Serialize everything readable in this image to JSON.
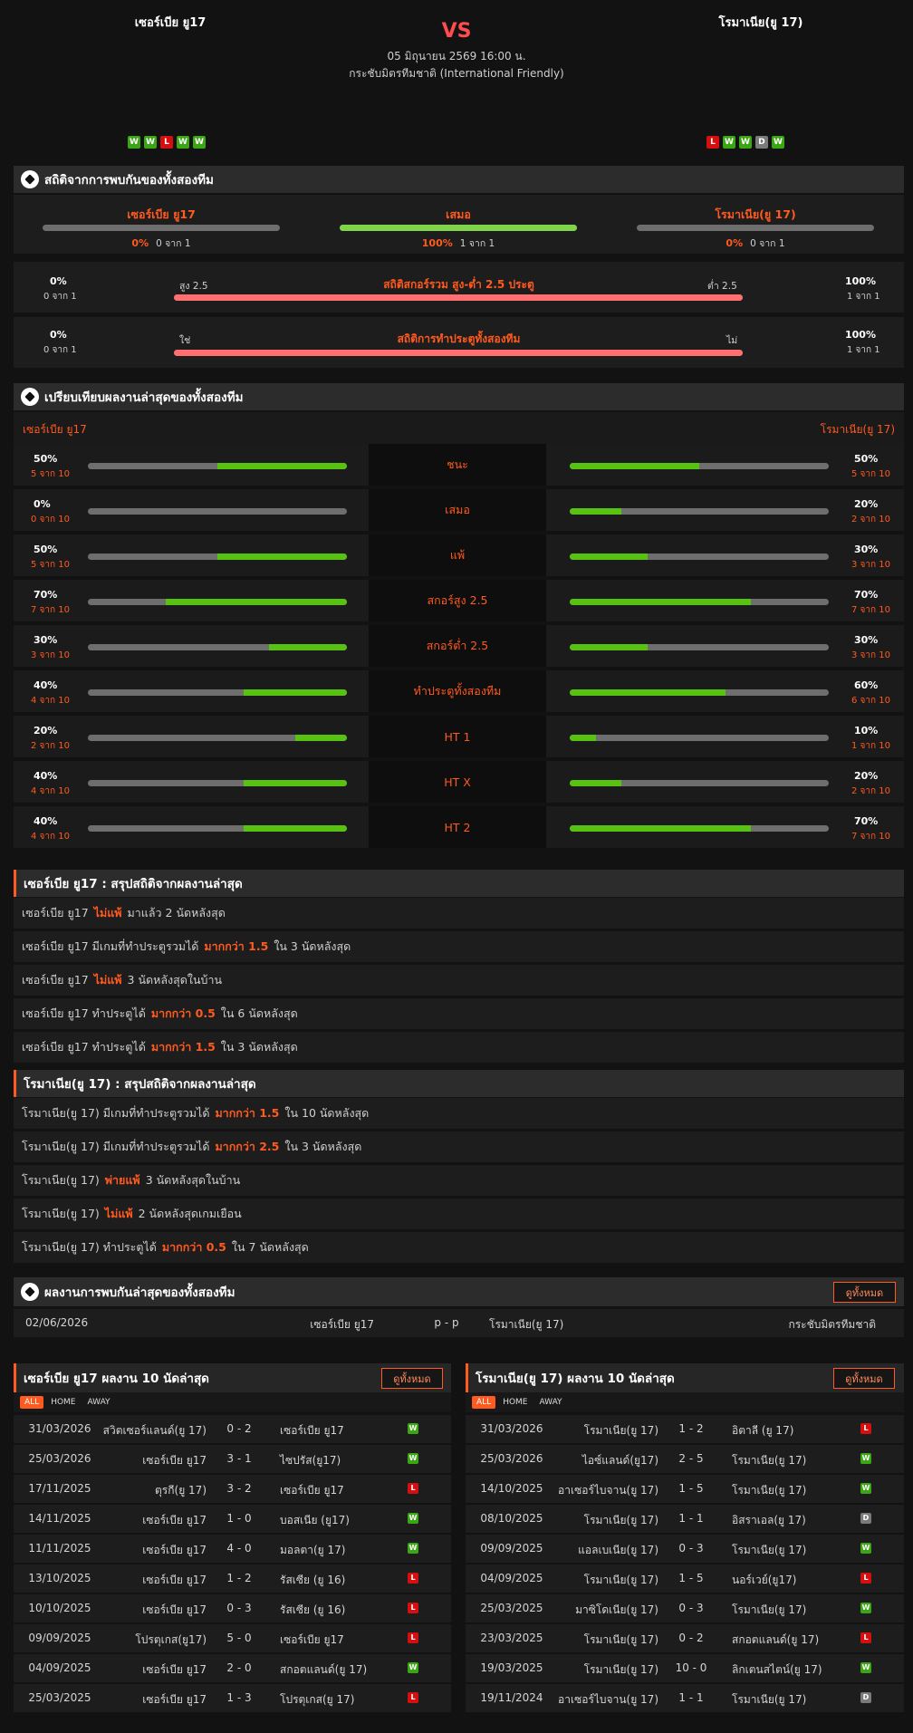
{
  "header": {
    "home": "เซอร์เบีย ยู17",
    "away": "โรมาเนีย(ยู 17)",
    "vs": "VS",
    "datetime": "05 มิถุนายน 2569 16:00 น.",
    "competition": "กระชับมิตรทีมชาติ (International Friendly)",
    "home_form": [
      "W",
      "W",
      "L",
      "W",
      "W"
    ],
    "away_form": [
      "L",
      "W",
      "W",
      "D",
      "W"
    ]
  },
  "h2h_stats": {
    "title": "สถิติจากการพบกันของทั้งสองทีม",
    "results": [
      {
        "label": "เซอร์เบีย ยู17",
        "pct": "0%",
        "frac": "0 จาก 1",
        "value": 0
      },
      {
        "label": "เสมอ",
        "pct": "100%",
        "frac": "1 จาก 1",
        "value": 100
      },
      {
        "label": "โรมาเนีย(ยู 17)",
        "pct": "0%",
        "frac": "0 จาก 1",
        "value": 0
      }
    ],
    "ou": {
      "left_pct": "0%",
      "left_frac": "0 จาก 1",
      "left_label": "สูง 2.5",
      "title": "สถิติสกอร์รวม สูง-ต่ำ 2.5 ประตู",
      "right_label": "ต่ำ 2.5",
      "right_pct": "100%",
      "right_frac": "1 จาก 1",
      "value": 100
    },
    "btts": {
      "left_pct": "0%",
      "left_frac": "0 จาก 1",
      "left_label": "ใช่",
      "title": "สถิติการทำประตูทั้งสองทีม",
      "right_label": "ไม่",
      "right_pct": "100%",
      "right_frac": "1 จาก 1",
      "value": 100
    }
  },
  "compare": {
    "title": "เปรียบเทียบผลงานล่าสุดของทั้งสองทีม",
    "home": "เซอร์เบีย ยู17",
    "away": "โรมาเนีย(ยู 17)",
    "rows": [
      {
        "label": "ชนะ",
        "hp": "50%",
        "hf": "5 จาก 10",
        "hv": 50,
        "ap": "50%",
        "af": "5 จาก 10",
        "av": 50
      },
      {
        "label": "เสมอ",
        "hp": "0%",
        "hf": "0 จาก 10",
        "hv": 0,
        "ap": "20%",
        "af": "2 จาก 10",
        "av": 20
      },
      {
        "label": "แพ้",
        "hp": "50%",
        "hf": "5 จาก 10",
        "hv": 50,
        "ap": "30%",
        "af": "3 จาก 10",
        "av": 30
      },
      {
        "label": "สกอร์สูง 2.5",
        "hp": "70%",
        "hf": "7 จาก 10",
        "hv": 70,
        "ap": "70%",
        "af": "7 จาก 10",
        "av": 70
      },
      {
        "label": "สกอร์ต่ำ 2.5",
        "hp": "30%",
        "hf": "3 จาก 10",
        "hv": 30,
        "ap": "30%",
        "af": "3 จาก 10",
        "av": 30
      },
      {
        "label": "ทำประตูทั้งสองทีม",
        "hp": "40%",
        "hf": "4 จาก 10",
        "hv": 40,
        "ap": "60%",
        "af": "6 จาก 10",
        "av": 60
      },
      {
        "label": "HT 1",
        "hp": "20%",
        "hf": "2 จาก 10",
        "hv": 20,
        "ap": "10%",
        "af": "1 จาก 10",
        "av": 10
      },
      {
        "label": "HT X",
        "hp": "40%",
        "hf": "4 จาก 10",
        "hv": 40,
        "ap": "20%",
        "af": "2 จาก 10",
        "av": 20
      },
      {
        "label": "HT 2",
        "hp": "40%",
        "hf": "4 จาก 10",
        "hv": 40,
        "ap": "70%",
        "af": "7 จาก 10",
        "av": 70
      }
    ]
  },
  "home_summary": {
    "title": "เซอร์เบีย ยู17 : สรุปสถิติจากผลงานล่าสุด",
    "rows": [
      [
        "เซอร์เบีย ยู17",
        "ไม่แพ้",
        "มาแล้ว 2 นัดหลังสุด"
      ],
      [
        "เซอร์เบีย ยู17 มีเกมที่ทำประตูรวมได้",
        "มากกว่า  1.5",
        "ใน 3 นัดหลังสุด"
      ],
      [
        "เซอร์เบีย ยู17",
        "ไม่แพ้",
        "3  นัดหลังสุดในบ้าน"
      ],
      [
        "เซอร์เบีย ยู17  ทำประตูได้",
        "มากกว่า  0.5",
        "ใน 6 นัดหลังสุด"
      ],
      [
        "เซอร์เบีย ยู17  ทำประตูได้",
        "มากกว่า  1.5",
        "ใน 3 นัดหลังสุด"
      ]
    ]
  },
  "away_summary": {
    "title": "โรมาเนีย(ยู 17) : สรุปสถิติจากผลงานล่าสุด",
    "rows": [
      [
        "โรมาเนีย(ยู 17)  มีเกมที่ทำประตูรวมได้",
        "มากกว่า  1.5",
        "ใน 10 นัดหลังสุด"
      ],
      [
        "โรมาเนีย(ยู 17)  มีเกมที่ทำประตูรวมได้",
        "มากกว่า  2.5",
        "ใน 3 นัดหลังสุด"
      ],
      [
        "โรมาเนีย(ยู 17)",
        "พ่ายแพ้",
        "3  นัดหลังสุดในบ้าน"
      ],
      [
        "โรมาเนีย(ยู 17)",
        "ไม่แพ้",
        "2  นัดหลังสุดเกมเยือน"
      ],
      [
        "โรมาเนีย(ยู 17)  ทำประตูได้",
        "มากกว่า  0.5",
        "ใน 7 นัดหลังสุด"
      ]
    ]
  },
  "h2h_matches": {
    "title": "ผลงานการพบกันล่าสุดของทั้งสองทีม",
    "view_all": "ดูทั้งหมด",
    "rows": [
      {
        "date": "02/06/2026",
        "home": "เซอร์เบีย ยู17",
        "score": "p - p",
        "away": "โรมาเนีย(ยู 17)",
        "comp": "กระชับมิตรทีมชาติ"
      }
    ]
  },
  "tabs": [
    "ALL",
    "HOME",
    "AWAY"
  ],
  "home_last10": {
    "title": "เซอร์เบีย ยู17 ผลงาน 10 นัดล่าสุด",
    "view_all": "ดูทั้งหมด",
    "rows": [
      {
        "date": "31/03/2026",
        "home": "สวิตเซอร์แลนด์(ยู 17)",
        "score": "0 - 2",
        "away": "เซอร์เบีย ยู17",
        "res": "W"
      },
      {
        "date": "25/03/2026",
        "home": "เซอร์เบีย ยู17",
        "score": "3 - 1",
        "away": "ไซปรัส(ยู17)",
        "res": "W"
      },
      {
        "date": "17/11/2025",
        "home": "ตุรกี(ยู 17)",
        "score": "3 - 2",
        "away": "เซอร์เบีย ยู17",
        "res": "L"
      },
      {
        "date": "14/11/2025",
        "home": "เซอร์เบีย ยู17",
        "score": "1 - 0",
        "away": "บอสเนีย (ยู17)",
        "res": "W"
      },
      {
        "date": "11/11/2025",
        "home": "เซอร์เบีย ยู17",
        "score": "4 - 0",
        "away": "มอลตา(ยู 17)",
        "res": "W"
      },
      {
        "date": "13/10/2025",
        "home": "เซอร์เบีย ยู17",
        "score": "1 - 2",
        "away": "รัสเซีย (ยู 16)",
        "res": "L"
      },
      {
        "date": "10/10/2025",
        "home": "เซอร์เบีย ยู17",
        "score": "0 - 3",
        "away": "รัสเซีย (ยู 16)",
        "res": "L"
      },
      {
        "date": "09/09/2025",
        "home": "โปรตุเกส(ยู17)",
        "score": "5 - 0",
        "away": "เซอร์เบีย ยู17",
        "res": "L"
      },
      {
        "date": "04/09/2025",
        "home": "เซอร์เบีย ยู17",
        "score": "2 - 0",
        "away": "สกอตแลนด์(ยู 17)",
        "res": "W"
      },
      {
        "date": "25/03/2025",
        "home": "เซอร์เบีย ยู17",
        "score": "1 - 3",
        "away": "โปรตุเกส(ยู 17)",
        "res": "L"
      }
    ]
  },
  "away_last10": {
    "title": "โรมาเนีย(ยู 17) ผลงาน 10 นัดล่าสุด",
    "view_all": "ดูทั้งหมด",
    "rows": [
      {
        "date": "31/03/2026",
        "home": "โรมาเนีย(ยู 17)",
        "score": "1 - 2",
        "away": "อิตาลี (ยู 17)",
        "res": "L"
      },
      {
        "date": "25/03/2026",
        "home": "ไอซ์แลนด์(ยู17)",
        "score": "2 - 5",
        "away": "โรมาเนีย(ยู 17)",
        "res": "W"
      },
      {
        "date": "14/10/2025",
        "home": "อาเซอร์ไบจาน(ยู 17)",
        "score": "1 - 5",
        "away": "โรมาเนีย(ยู 17)",
        "res": "W"
      },
      {
        "date": "08/10/2025",
        "home": "โรมาเนีย(ยู 17)",
        "score": "1 - 1",
        "away": "อิสราเอล(ยู 17)",
        "res": "D"
      },
      {
        "date": "09/09/2025",
        "home": "แอลเบเนีย(ยู 17)",
        "score": "0 - 3",
        "away": "โรมาเนีย(ยู 17)",
        "res": "W"
      },
      {
        "date": "04/09/2025",
        "home": "โรมาเนีย(ยู 17)",
        "score": "1 - 5",
        "away": "นอร์เวย์(ยู17)",
        "res": "L"
      },
      {
        "date": "25/03/2025",
        "home": "มาซิโดเนีย(ยู 17)",
        "score": "0 - 3",
        "away": "โรมาเนีย(ยู 17)",
        "res": "W"
      },
      {
        "date": "23/03/2025",
        "home": "โรมาเนีย(ยู 17)",
        "score": "0 - 2",
        "away": "สกอตแลนด์(ยู 17)",
        "res": "L"
      },
      {
        "date": "19/03/2025",
        "home": "โรมาเนีย(ยู 17)",
        "score": "10 - 0",
        "away": "ลิกเตนสไตน์(ยู 17)",
        "res": "W"
      },
      {
        "date": "19/11/2024",
        "home": "อาเซอร์ไบจาน(ยู 17)",
        "score": "1 - 1",
        "away": "โรมาเนีย(ยู 17)",
        "res": "D"
      }
    ]
  },
  "colors": {
    "accent": "#ff5a1f",
    "win": "#3aa613",
    "loss": "#d50f0f",
    "draw": "#7a7a7a",
    "bar_green": "#58c213",
    "bar_red": "#ff6f6f"
  }
}
